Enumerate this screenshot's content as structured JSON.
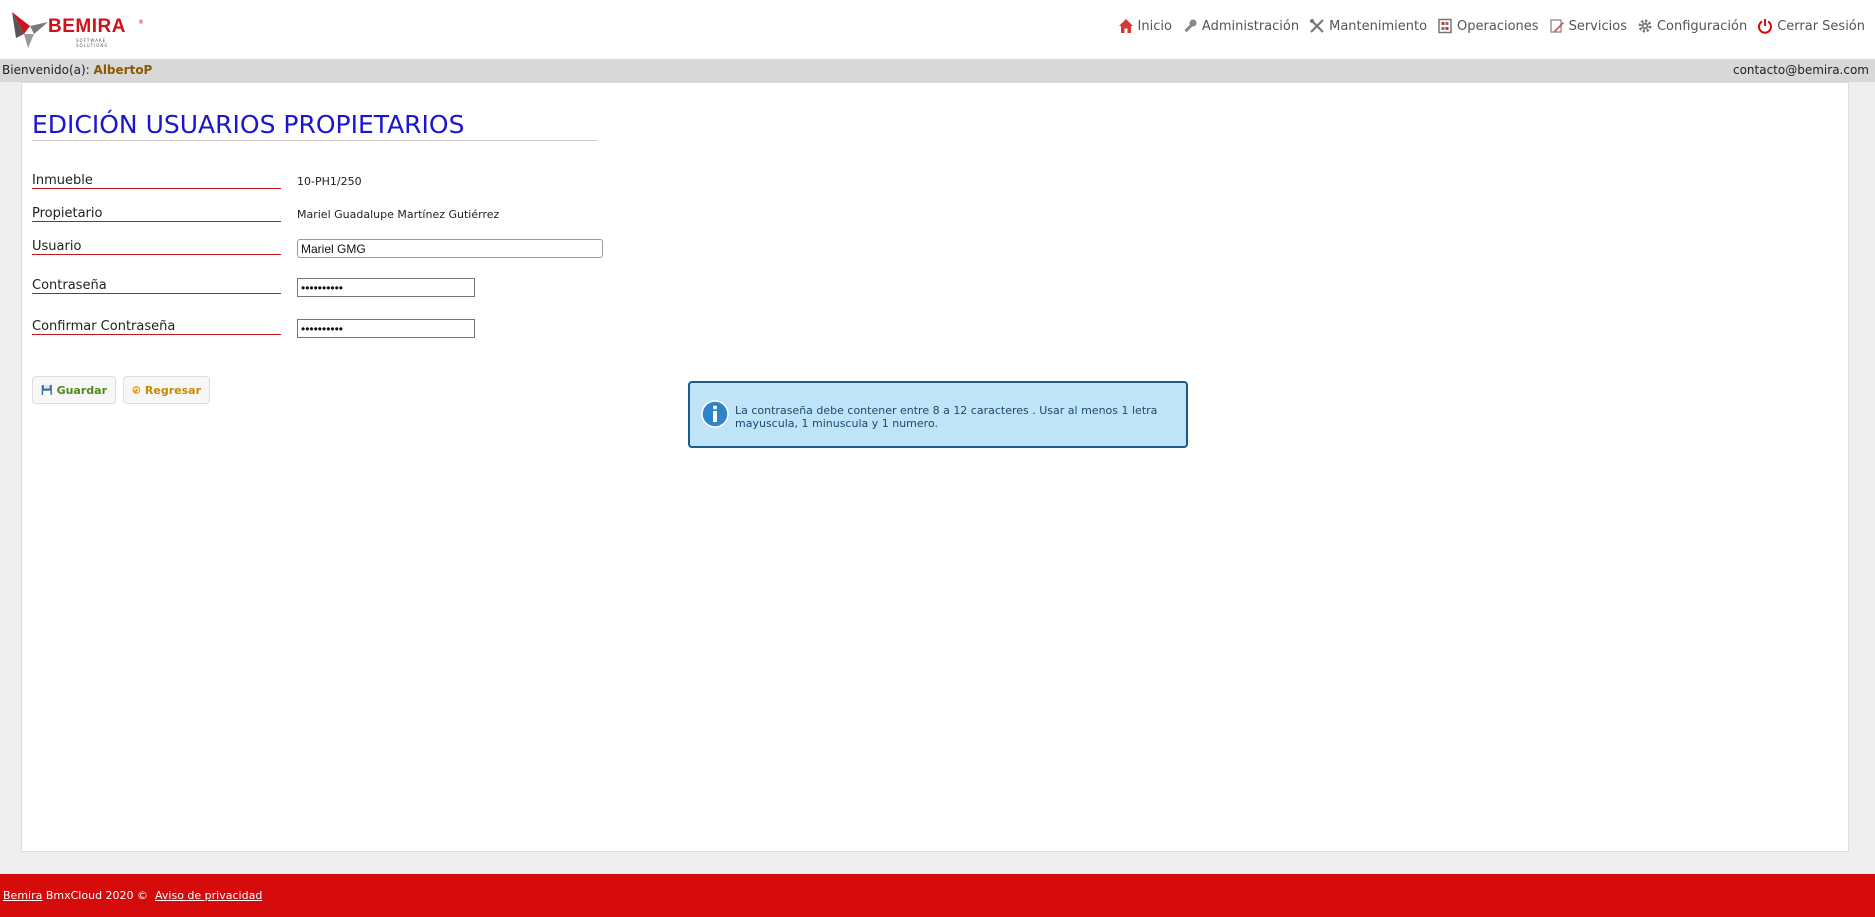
{
  "brand": {
    "name": "BEMIRA",
    "tagline": "SOFTWARE SOLUTIONS",
    "reg": "®",
    "color": "#d0111a"
  },
  "nav": [
    {
      "label": "Inicio",
      "icon": "home-icon"
    },
    {
      "label": "Administración",
      "icon": "key-icon"
    },
    {
      "label": "Mantenimiento",
      "icon": "tools-icon"
    },
    {
      "label": "Operaciones",
      "icon": "calculator-icon"
    },
    {
      "label": "Servicios",
      "icon": "edit-icon"
    },
    {
      "label": "Configuración",
      "icon": "gear-icon"
    },
    {
      "label": "Cerrar Sesión",
      "icon": "power-icon"
    }
  ],
  "userbar": {
    "welcome_label": "Bienvenido(a):",
    "username": "AlbertoP",
    "contact": "contacto@bemira.com"
  },
  "page": {
    "title": "EDICIÓN USUARIOS PROPIETARIOS"
  },
  "form": {
    "inmueble_label": "Inmueble",
    "inmueble_value": "10-PH1/250",
    "propietario_label": "Propietario",
    "propietario_value": "Mariel Guadalupe Martínez Gutiérrez",
    "usuario_label": "Usuario",
    "usuario_value": "Mariel GMG",
    "password_label": "Contraseña",
    "password_value": "••••••••••",
    "confirm_label": "Confirmar Contraseña",
    "confirm_value": "••••••••••"
  },
  "buttons": {
    "save_label": "Guardar",
    "back_label": "Regresar"
  },
  "info": {
    "line1": "La contraseña debe contener entre 8 a 12 caracteres . Usar al menos 1 letra",
    "line2": "mayuscula, 1 minuscula y 1 numero."
  },
  "footer": {
    "brand_link": "Bemira",
    "text": " BmxCloud 2020 ©  ",
    "privacy_link": "Aviso de privacidad"
  },
  "colors": {
    "accent_red": "#d50b0b",
    "title_blue": "#1b14d0",
    "info_bg": "#bfe4f7"
  }
}
